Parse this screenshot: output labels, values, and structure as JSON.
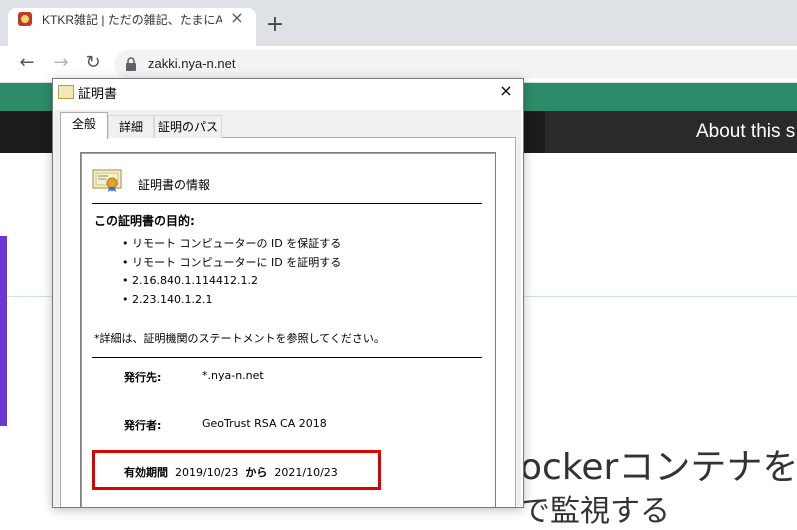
{
  "browser": {
    "tab_title": "KTKR雑記 | ただの雑記、たまにAzure",
    "tab_close": "×",
    "new_tab": "+",
    "back": "←",
    "forward": "→",
    "reload": "↻",
    "url": "zakki.nya-n.net",
    "icons": [
      "tab-favicon-icon",
      "lock-icon"
    ]
  },
  "site": {
    "nav_about": "About this s",
    "heading": "ockerコンテナをA",
    "subheading": "で監視する"
  },
  "dialog": {
    "title": "証明書",
    "close": "×",
    "tabs": [
      "全般",
      "詳細",
      "証明のパス"
    ],
    "info_title": "証明書の情報",
    "purpose_heading": "この証明書の目的:",
    "purposes": [
      "• リモート コンピューターの ID を保証する",
      "• リモート コンピューターに ID を証明する",
      "• 2.16.840.1.114412.1.2",
      "• 2.23.140.1.2.1"
    ],
    "note": "*詳細は、証明機関のステートメントを参照してください。",
    "issued_to_label": "発行先:",
    "issued_to_value": "*.nya-n.net",
    "issued_by_label": "発行者:",
    "issued_by_value": "GeoTrust RSA CA 2018",
    "validity_label": "有効期間",
    "valid_from": "2019/10/23",
    "from_word": "から",
    "valid_to": "2021/10/23"
  },
  "colors": {
    "site_green": "#2e8b6a",
    "highlight_red": "#e00000"
  }
}
